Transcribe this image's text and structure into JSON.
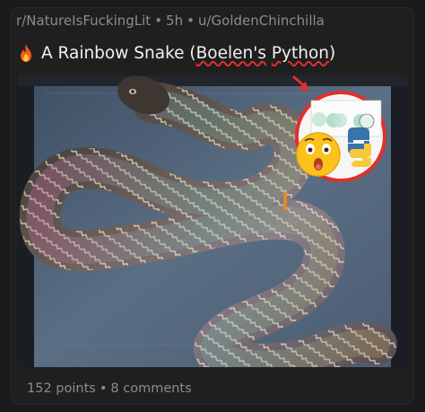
{
  "post": {
    "subreddit": "r/NatureIsFuckingLit",
    "age": "5h",
    "author": "u/GoldenChinchilla",
    "separator": "•",
    "title_prefix": "A Rainbow Snake (",
    "title_word1": "Boelen's",
    "title_word2": "Python",
    "title_suffix": ")",
    "points": "152 points",
    "comments": "8 comments"
  },
  "icons": {
    "flame": "fire-icon",
    "thumbnail_emoji": "astonished-face-icon",
    "thumbnail_logo": "python-logo-icon",
    "thumbnail_arrow": "red-arrow-icon"
  },
  "colors": {
    "background": "#1a1a1b",
    "card": "#1f1f20",
    "meta_text": "#8a8d90",
    "title_text": "#f1f1f1",
    "spellcheck": "#e0302b"
  }
}
